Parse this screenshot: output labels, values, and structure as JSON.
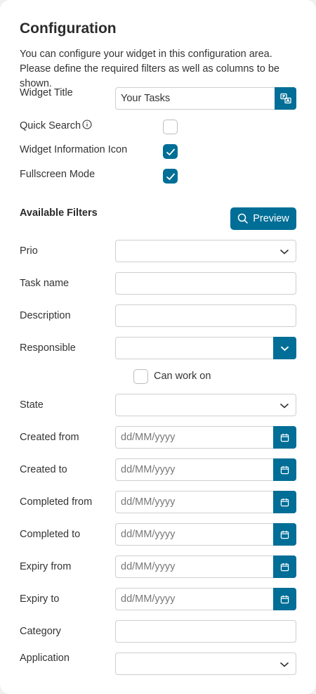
{
  "header": {
    "title": "Configuration",
    "description": "You can configure your widget in this configuration area. Please define the required filters as well as columns to be shown."
  },
  "settings": {
    "widget_title_label": "Widget Title",
    "widget_title_value": "Your Tasks",
    "quick_search_label": "Quick Search",
    "quick_search_checked": false,
    "info_icon_label": "Widget Information Icon",
    "info_icon_checked": true,
    "fullscreen_label": "Fullscreen Mode",
    "fullscreen_checked": true
  },
  "filters": {
    "section_title": "Available Filters",
    "preview_label": "Preview",
    "prio_label": "Prio",
    "task_name_label": "Task name",
    "description_label": "Description",
    "responsible_label": "Responsible",
    "can_work_on_label": "Can work on",
    "can_work_on_checked": false,
    "state_label": "State",
    "created_from_label": "Created from",
    "created_to_label": "Created to",
    "completed_from_label": "Completed from",
    "completed_to_label": "Completed to",
    "expiry_from_label": "Expiry from",
    "expiry_to_label": "Expiry to",
    "category_label": "Category",
    "application_label": "Application",
    "date_placeholder": "dd/MM/yyyy"
  },
  "colors": {
    "accent": "#006e96"
  },
  "icons": [
    "translate-icon",
    "info-icon",
    "check-icon",
    "search-icon",
    "chevron-down-icon",
    "calendar-icon"
  ]
}
